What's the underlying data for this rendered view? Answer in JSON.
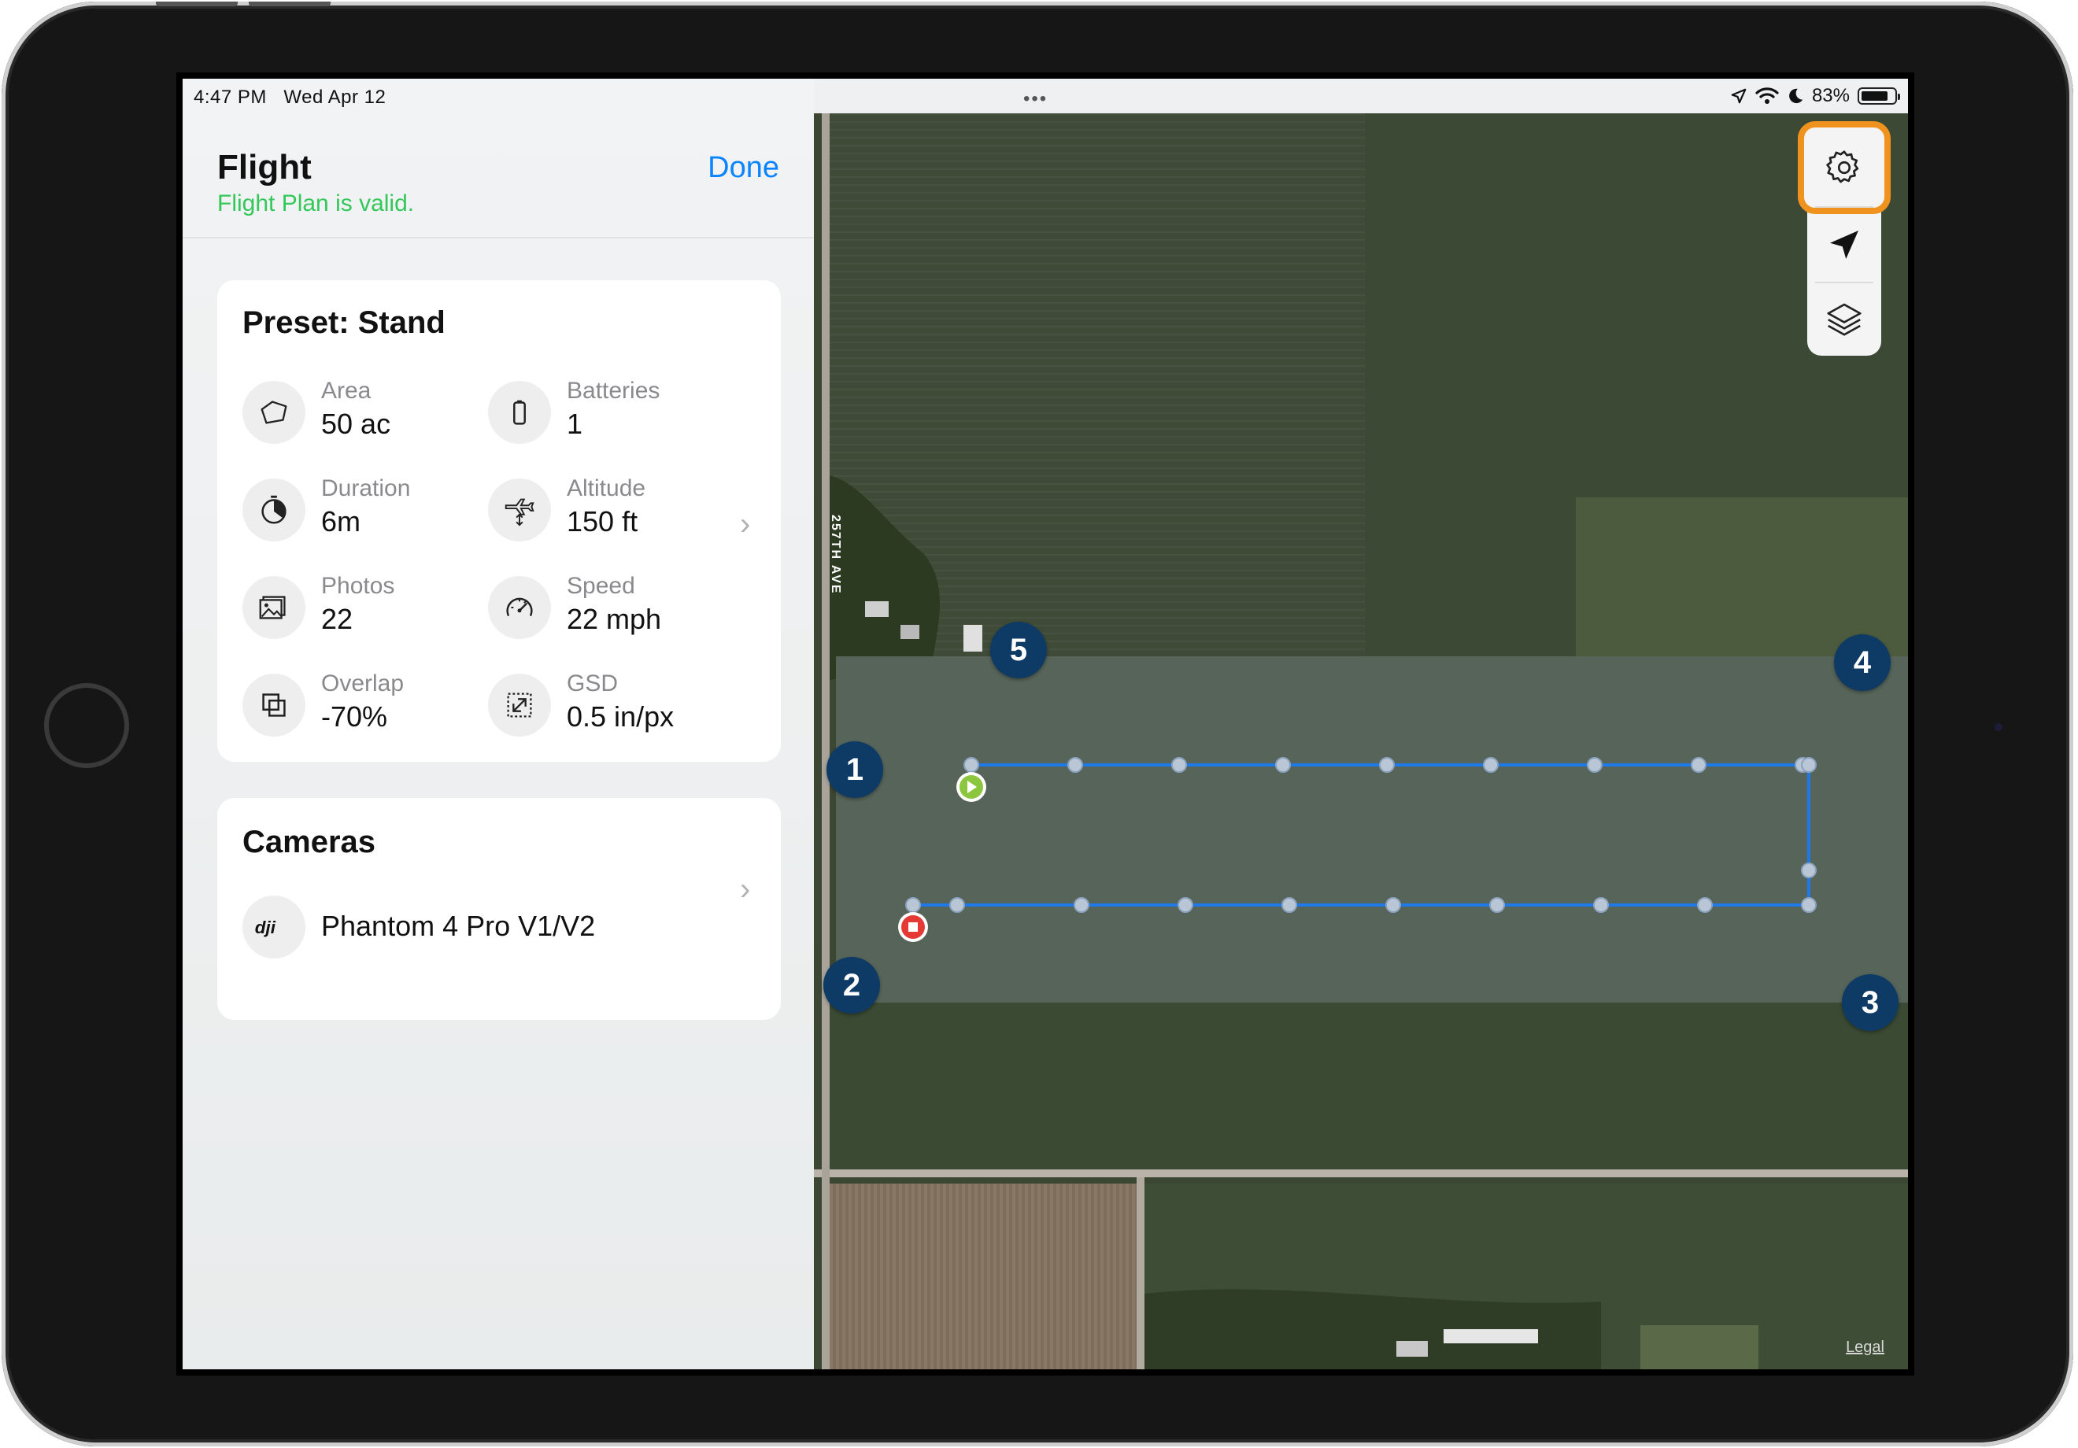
{
  "status_bar": {
    "time": "4:47 PM",
    "date": "Wed Apr 12",
    "dots": "•••",
    "battery_percent": "83%",
    "battery_level": 0.83
  },
  "panel": {
    "title": "Flight",
    "subtitle": "Flight Plan is valid.",
    "done_label": "Done",
    "subtitle_color": "#34c759",
    "accent_color": "#0a84ff"
  },
  "preset": {
    "title": "Preset: Stand",
    "stats": {
      "area": {
        "label": "Area",
        "value": "50 ac",
        "icon": "area-icon"
      },
      "batteries": {
        "label": "Batteries",
        "value": "1",
        "icon": "battery-icon"
      },
      "duration": {
        "label": "Duration",
        "value": "6m",
        "icon": "timer-icon"
      },
      "altitude": {
        "label": "Altitude",
        "value": "150 ft",
        "icon": "altitude-icon"
      },
      "photos": {
        "label": "Photos",
        "value": "22",
        "icon": "photos-icon"
      },
      "speed": {
        "label": "Speed",
        "value": "22 mph",
        "icon": "speedometer-icon"
      },
      "overlap": {
        "label": "Overlap",
        "value": "-70%",
        "icon": "overlap-icon"
      },
      "gsd": {
        "label": "GSD",
        "value": "0.5 in/px",
        "icon": "gsd-icon"
      }
    }
  },
  "cameras": {
    "title": "Cameras",
    "camera_name": "Phantom 4 Pro V1/V2",
    "brand_logo": "dji"
  },
  "map": {
    "road_label": "257TH AVE",
    "legal_label": "Legal",
    "markers": [
      "1",
      "2",
      "3",
      "4",
      "5"
    ],
    "path_color": "#1d7ae8",
    "start_color": "#8cc63f",
    "stop_color": "#e53935",
    "settings_highlight_color": "#f0921e"
  }
}
